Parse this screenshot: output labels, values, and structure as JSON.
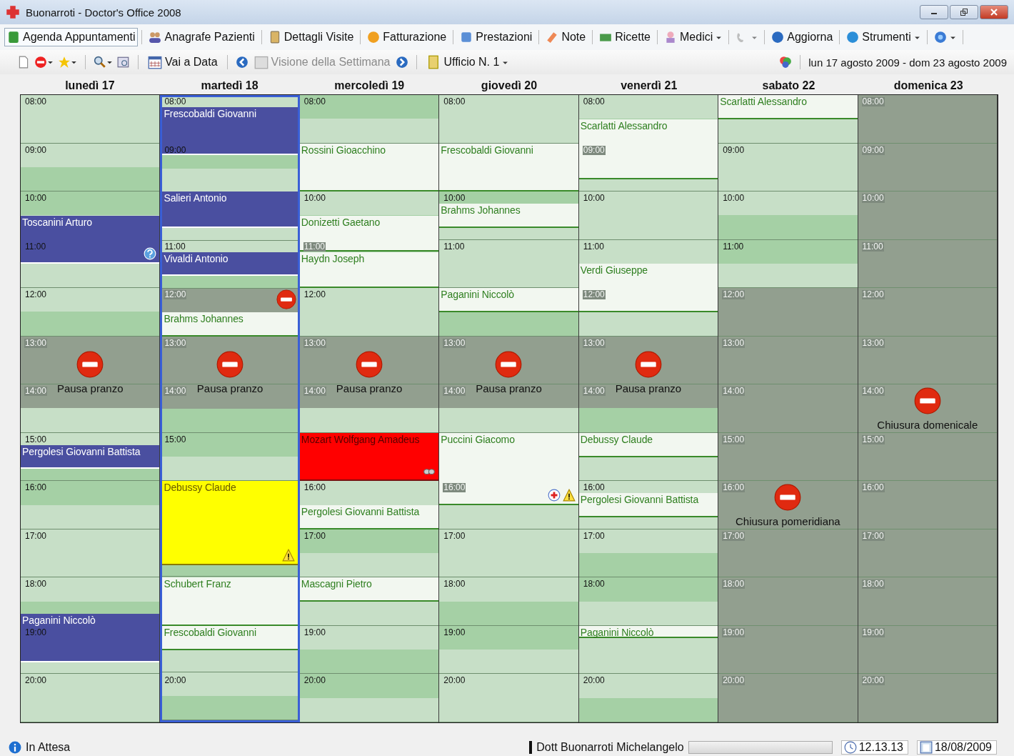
{
  "window": {
    "title": "Buonarroti - Doctor's Office 2008"
  },
  "menu": [
    {
      "label": "Agenda Appuntamenti",
      "selected": true,
      "dropdown": false,
      "disabled": false
    },
    {
      "label": "Anagrafe Pazienti",
      "selected": false,
      "dropdown": false,
      "disabled": false
    },
    {
      "label": "Dettagli Visite",
      "selected": false,
      "dropdown": false,
      "disabled": false
    },
    {
      "label": "Fatturazione",
      "selected": false,
      "dropdown": false,
      "disabled": false
    },
    {
      "label": "Prestazioni",
      "selected": false,
      "dropdown": false,
      "disabled": false
    },
    {
      "label": "Note",
      "selected": false,
      "dropdown": false,
      "disabled": false
    },
    {
      "label": "Ricette",
      "selected": false,
      "dropdown": false,
      "disabled": false
    },
    {
      "label": "Medici",
      "selected": false,
      "dropdown": true,
      "disabled": false
    },
    {
      "selected": false,
      "dropdown": true,
      "disabled": true
    },
    {
      "label": "Aggiorna",
      "selected": false,
      "dropdown": false,
      "disabled": false
    },
    {
      "label": "Strumenti",
      "selected": false,
      "dropdown": true,
      "disabled": false
    },
    {
      "selected": false,
      "dropdown": true,
      "disabled": false
    }
  ],
  "toolbar": {
    "goto_date": "Vai a Data",
    "week_view": {
      "label": "Visione della Settimana",
      "disabled": true
    },
    "office": "Ufficio N. 1",
    "date_range": "lun 17 agosto 2009 - dom 23 agosto 2009"
  },
  "days": [
    {
      "name": "lunedì 17",
      "selected": false,
      "hours": [
        {
          "label": "08:00",
          "faded": false
        },
        {
          "label": "09:00",
          "faded": false
        },
        {
          "label": "10:00",
          "faded": false
        },
        {
          "label": "11:00",
          "faded": false
        },
        {
          "label": "12:00",
          "faded": false
        },
        {
          "label": "13:00",
          "faded": true
        },
        {
          "label": "14:00",
          "faded": true
        },
        {
          "label": "15:00",
          "faded": false
        },
        {
          "label": "16:00",
          "faded": false
        },
        {
          "label": "17:00",
          "faded": false
        },
        {
          "label": "18:00",
          "faded": false
        },
        {
          "label": "19:00",
          "faded": false
        },
        {
          "label": "20:00",
          "faded": false
        }
      ],
      "closures": [
        {
          "label": "Pausa pranzo"
        }
      ],
      "appointments": [
        {
          "patient": "Toscanini Arturo",
          "color": "#4a4fa0"
        },
        {
          "patient": "Pergolesi Giovanni Battista",
          "color": "#4a4fa0"
        },
        {
          "patient": "Paganini Niccolò",
          "color": "#4a4fa0"
        }
      ]
    },
    {
      "name": "martedì 18",
      "selected": true,
      "hours": [
        {
          "label": "08:00",
          "faded": false
        },
        {
          "label": "09:00",
          "faded": false
        },
        {
          "label": "11:00",
          "faded": false
        },
        {
          "label": "12:00",
          "faded": true
        },
        {
          "label": "13:00",
          "faded": true
        },
        {
          "label": "14:00",
          "faded": true
        },
        {
          "label": "15:00",
          "faded": false
        },
        {
          "label": "20:00",
          "faded": false
        }
      ],
      "closures": [
        {
          "label": "Pausa pranzo"
        }
      ],
      "appointments": [
        {
          "patient": "Frescobaldi Giovanni",
          "color": "#4a4fa0"
        },
        {
          "patient": "Salieri Antonio",
          "color": "#4a4fa0"
        },
        {
          "patient": "Vivaldi Antonio",
          "color": "#4a4fa0"
        },
        {
          "patient": "Brahms Johannes",
          "color": "#f2f7f0"
        },
        {
          "patient": "Debussy Claude",
          "color": "#ffff00"
        },
        {
          "patient": "Schubert Franz",
          "color": "#f2f7f0"
        },
        {
          "patient": "Frescobaldi Giovanni",
          "color": "#f2f7f0"
        }
      ]
    },
    {
      "name": "mercoledì 19",
      "selected": false,
      "hours": [
        {
          "label": "08:00",
          "faded": false
        },
        {
          "label": "10:00",
          "faded": false
        },
        {
          "label": "11:00",
          "faded": true
        },
        {
          "label": "12:00",
          "faded": false
        },
        {
          "label": "13:00",
          "faded": true
        },
        {
          "label": "14:00",
          "faded": true
        },
        {
          "label": "16:00",
          "faded": false
        },
        {
          "label": "17:00",
          "faded": false
        },
        {
          "label": "19:00",
          "faded": false
        },
        {
          "label": "20:00",
          "faded": false
        }
      ],
      "closures": [
        {
          "label": "Pausa pranzo"
        }
      ],
      "appointments": [
        {
          "patient": "Rossini Gioacchino",
          "color": "#f2f7f0"
        },
        {
          "patient": "Donizetti Gaetano",
          "color": "#f2f7f0"
        },
        {
          "patient": "Haydn Joseph",
          "color": "#f2f7f0"
        },
        {
          "patient": "Mozart Wolfgang Amadeus",
          "color": "#ff0000"
        },
        {
          "patient": "Pergolesi Giovanni Battista",
          "color": "#f2f7f0"
        },
        {
          "patient": "Mascagni Pietro",
          "color": "#f2f7f0"
        }
      ]
    },
    {
      "name": "giovedì 20",
      "selected": false,
      "hours": [
        {
          "label": "08:00",
          "faded": false
        },
        {
          "label": "10:00",
          "faded": false
        },
        {
          "label": "11:00",
          "faded": false
        },
        {
          "label": "13:00",
          "faded": true
        },
        {
          "label": "14:00",
          "faded": true
        },
        {
          "label": "16:00",
          "faded": true
        },
        {
          "label": "17:00",
          "faded": false
        },
        {
          "label": "18:00",
          "faded": false
        },
        {
          "label": "19:00",
          "faded": false
        },
        {
          "label": "20:00",
          "faded": false
        }
      ],
      "closures": [
        {
          "label": "Pausa pranzo"
        }
      ],
      "appointments": [
        {
          "patient": "Frescobaldi Giovanni",
          "color": "#f2f7f0"
        },
        {
          "patient": "Brahms Johannes",
          "color": "#f2f7f0"
        },
        {
          "patient": "Paganini Niccolò",
          "color": "#f2f7f0"
        },
        {
          "patient": "Puccini Giacomo",
          "color": "#f2f7f0"
        }
      ]
    },
    {
      "name": "venerdì 21",
      "selected": false,
      "hours": [
        {
          "label": "08:00",
          "faded": false
        },
        {
          "label": "09:00",
          "faded": true
        },
        {
          "label": "10:00",
          "faded": false
        },
        {
          "label": "11:00",
          "faded": false
        },
        {
          "label": "12:00",
          "faded": true
        },
        {
          "label": "13:00",
          "faded": true
        },
        {
          "label": "14:00",
          "faded": true
        },
        {
          "label": "16:00",
          "faded": false
        },
        {
          "label": "17:00",
          "faded": false
        },
        {
          "label": "18:00",
          "faded": false
        },
        {
          "label": "20:00",
          "faded": false
        }
      ],
      "closures": [
        {
          "label": "Pausa pranzo"
        }
      ],
      "appointments": [
        {
          "patient": "Scarlatti Alessandro",
          "color": "#f2f7f0"
        },
        {
          "patient": "Verdi Giuseppe",
          "color": "#f2f7f0"
        },
        {
          "patient": "Debussy Claude",
          "color": "#f2f7f0"
        },
        {
          "patient": "Pergolesi Giovanni Battista",
          "color": "#f2f7f0"
        },
        {
          "patient": "Paganini Niccolò",
          "color": "#f2f7f0"
        }
      ]
    },
    {
      "name": "sabato 22",
      "selected": false,
      "hours": [
        {
          "label": "09:00",
          "faded": false
        },
        {
          "label": "10:00",
          "faded": false
        },
        {
          "label": "11:00",
          "faded": false
        },
        {
          "label": "12:00",
          "faded": true
        },
        {
          "label": "13:00",
          "faded": true
        },
        {
          "label": "14:00",
          "faded": true
        },
        {
          "label": "15:00",
          "faded": true
        },
        {
          "label": "16:00",
          "faded": true
        },
        {
          "label": "17:00",
          "faded": true
        },
        {
          "label": "18:00",
          "faded": true
        },
        {
          "label": "19:00",
          "faded": true
        },
        {
          "label": "20:00",
          "faded": true
        }
      ],
      "closures": [
        {
          "label": "Chiusura pomeridiana"
        }
      ],
      "appointments": [
        {
          "patient": "Scarlatti Alessandro",
          "color": "#f2f7f0"
        }
      ]
    },
    {
      "name": "domenica 23",
      "selected": false,
      "hours": [
        {
          "label": "08:00",
          "faded": true
        },
        {
          "label": "09:00",
          "faded": true
        },
        {
          "label": "10:00",
          "faded": true
        },
        {
          "label": "11:00",
          "faded": true
        },
        {
          "label": "12:00",
          "faded": true
        },
        {
          "label": "13:00",
          "faded": true
        },
        {
          "label": "14:00",
          "faded": true
        },
        {
          "label": "15:00",
          "faded": true
        },
        {
          "label": "16:00",
          "faded": true
        },
        {
          "label": "17:00",
          "faded": true
        },
        {
          "label": "18:00",
          "faded": true
        },
        {
          "label": "19:00",
          "faded": true
        },
        {
          "label": "20:00",
          "faded": true
        }
      ],
      "closures": [
        {
          "label": "Chiusura domenicale"
        }
      ]
    }
  ],
  "status_bar": {
    "state": "In Attesa",
    "doctor": "Dott Buonarroti Michelangelo",
    "time": "12.13.13",
    "date": "18/08/2009"
  }
}
